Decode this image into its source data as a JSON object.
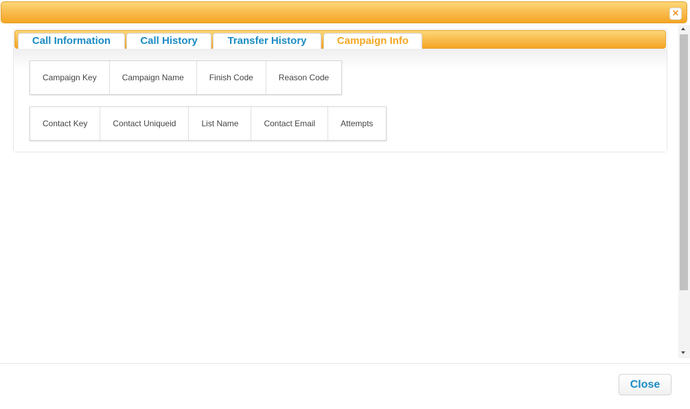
{
  "titlebar": {
    "close_glyph": "×",
    "close_icon": "close-icon"
  },
  "tabs": [
    {
      "label": "Call Information",
      "active": false
    },
    {
      "label": "Call History",
      "active": false
    },
    {
      "label": "Transfer History",
      "active": false
    },
    {
      "label": "Campaign Info",
      "active": true
    }
  ],
  "campaign_row": [
    "Campaign Key",
    "Campaign Name",
    "Finish Code",
    "Reason Code"
  ],
  "contact_row": [
    "Contact Key",
    "Contact Uniqueid",
    "List Name",
    "Contact Email",
    "Attempts"
  ],
  "footer": {
    "close_label": "Close"
  },
  "colors": {
    "accent_orange": "#f5a623",
    "link_blue": "#1a8bc4"
  }
}
